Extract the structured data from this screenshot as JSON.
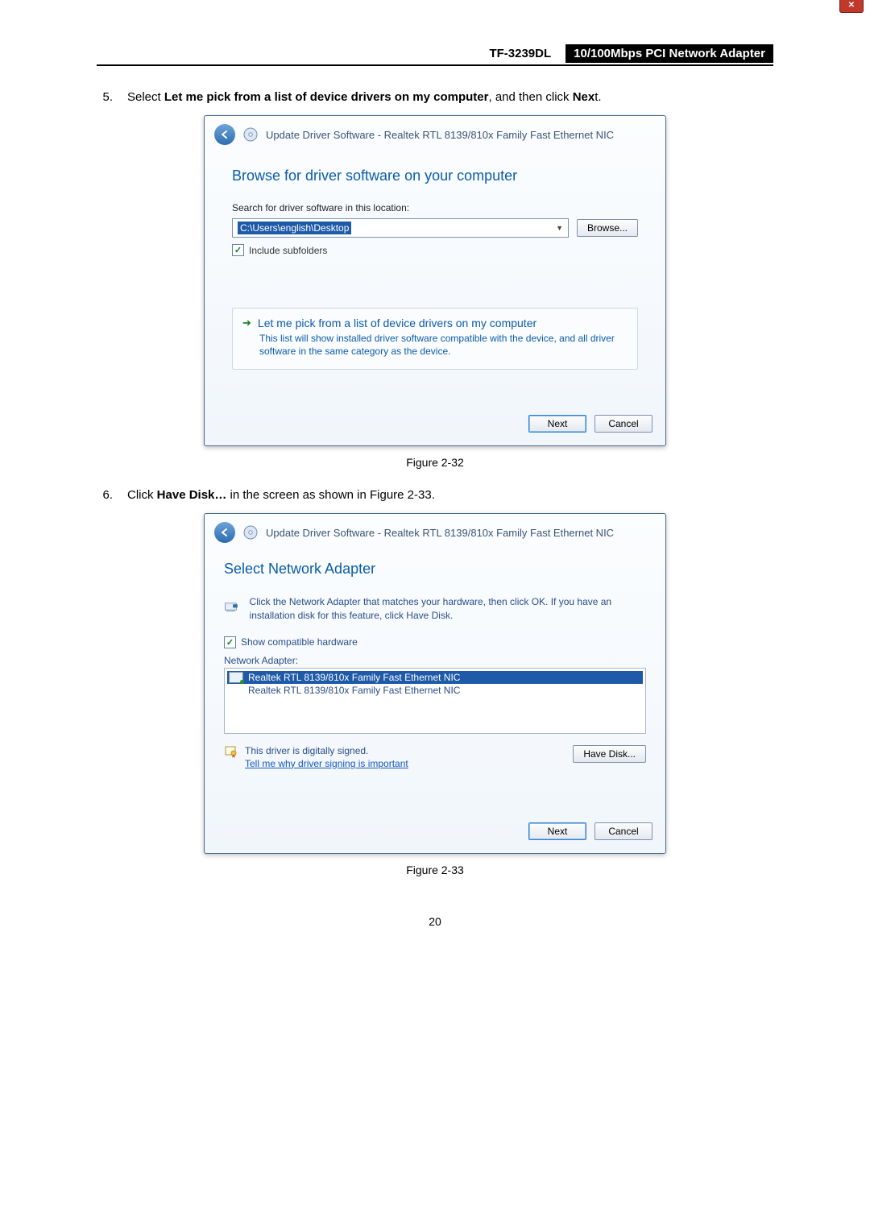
{
  "header": {
    "model": "TF-3239DL",
    "desc": "10/100Mbps PCI Network Adapter"
  },
  "step5": {
    "num": "5.",
    "pre": "Select ",
    "bold": "Let me pick from a list of device drivers on my computer",
    "mid": ", and then click ",
    "bold2": "Nex",
    "post": "t."
  },
  "dialog1": {
    "title": "Update Driver Software -  Realtek RTL 8139/810x Family Fast Ethernet NIC",
    "h1": "Browse for driver software on your computer",
    "search_lbl": "Search for driver software in this location:",
    "path": "C:\\Users\\english\\Desktop",
    "browse": "Browse...",
    "include": "Include subfolders",
    "link_title": "Let me pick from a list of device drivers on my computer",
    "link_sub": "This list will show installed driver software compatible with the device, and all driver software in the same category as the device.",
    "next": "Next",
    "cancel": "Cancel"
  },
  "figcap1": "Figure 2-32",
  "step6": {
    "num": "6.",
    "pre": "Click ",
    "bold": "Have Disk…",
    "post": " in the screen as shown in Figure 2-33."
  },
  "dialog2": {
    "title": "Update Driver Software -  Realtek RTL 8139/810x Family Fast Ethernet NIC",
    "h1": "Select Network Adapter",
    "desc": "Click the Network Adapter that matches your hardware, then click OK. If you have an installation disk for this feature, click Have Disk.",
    "show_compat": "Show compatible hardware",
    "list_lbl": "Network Adapter:",
    "item1": "Realtek RTL 8139/810x Family Fast Ethernet NIC",
    "item2": "Realtek RTL 8139/810x Family Fast Ethernet NIC",
    "signed": "This driver is digitally signed.",
    "signed_link": "Tell me why driver signing is important",
    "have_disk": "Have Disk...",
    "next": "Next",
    "cancel": "Cancel"
  },
  "figcap2": "Figure 2-33",
  "pagenum": "20"
}
